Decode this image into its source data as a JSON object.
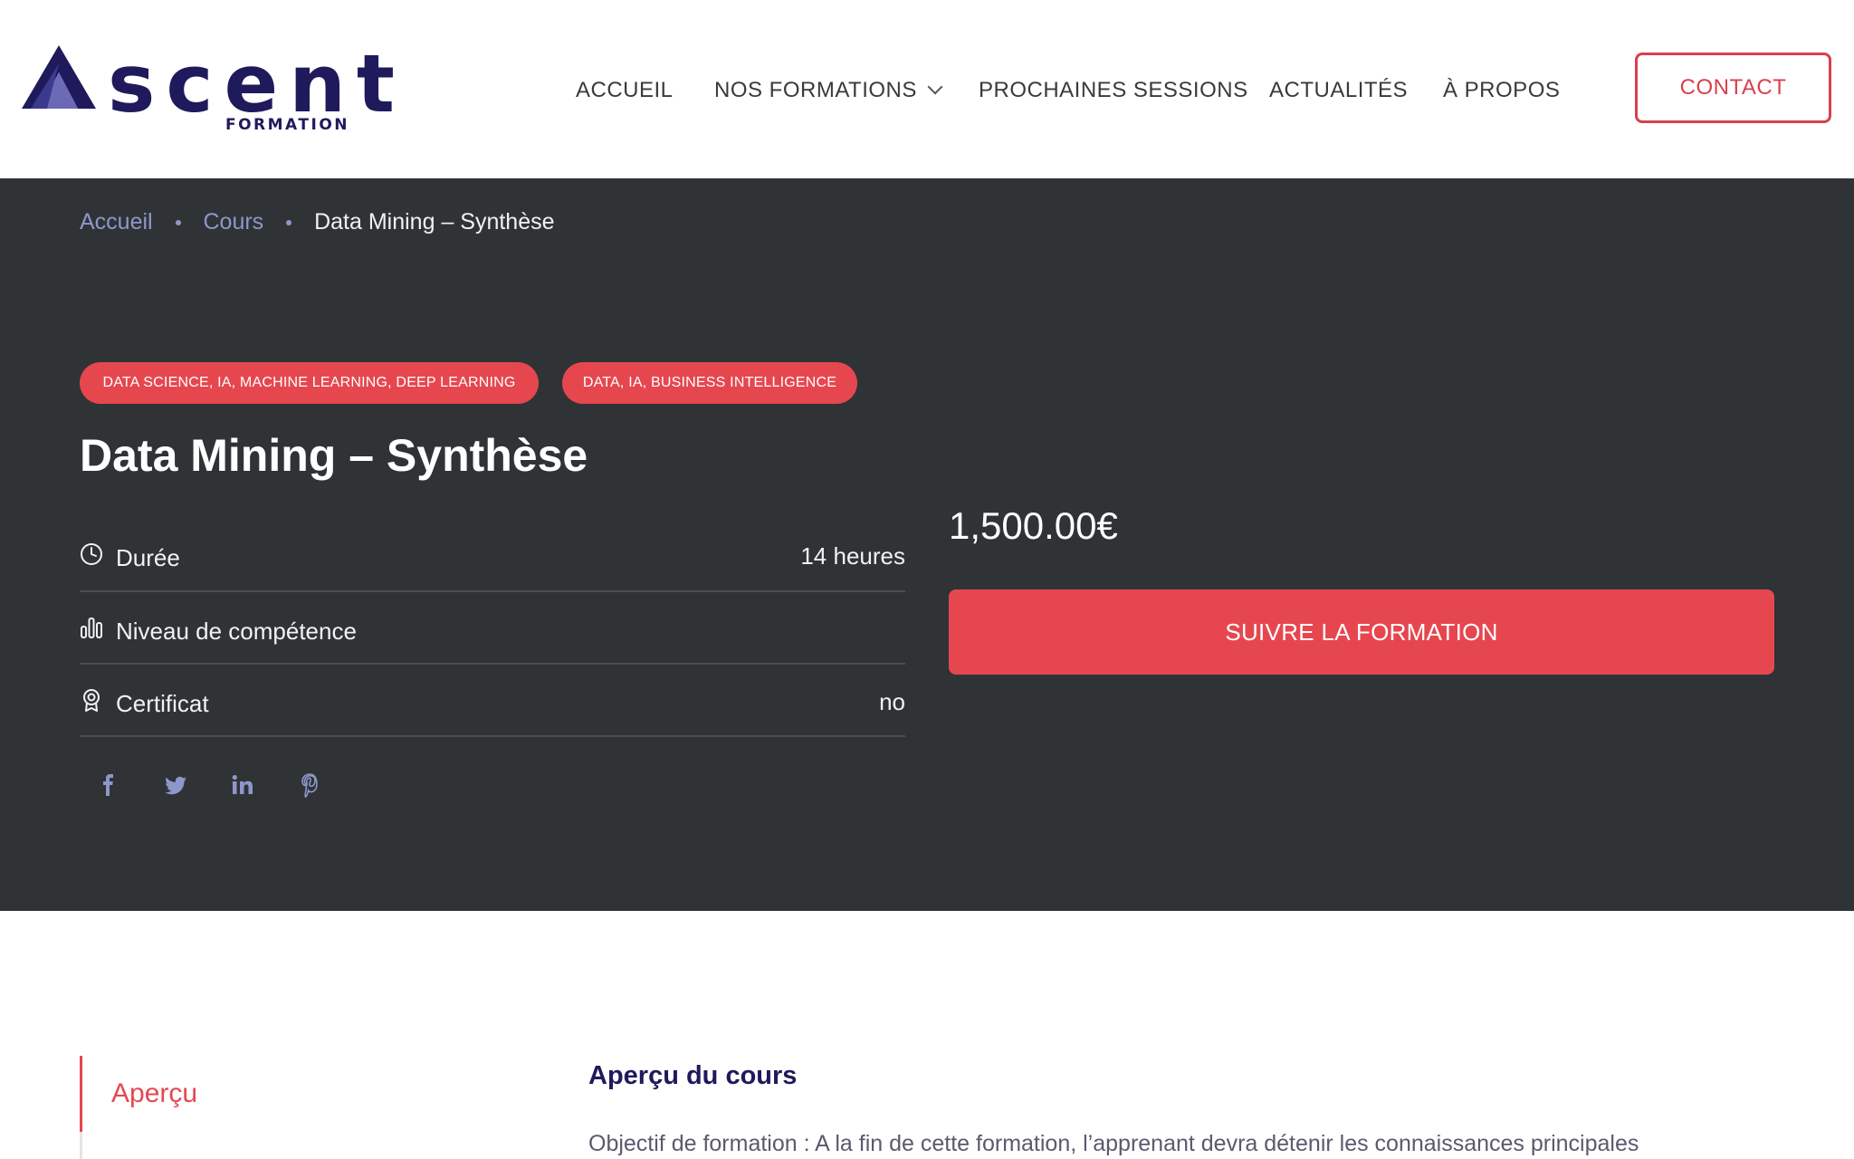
{
  "brand": {
    "name": "scent",
    "subtitle": "FORMATION",
    "primary_color": "#1f1a5c",
    "accent_color": "#e6474f"
  },
  "nav": {
    "items": [
      {
        "label": "ACCUEIL"
      },
      {
        "label": "NOS FORMATIONS",
        "has_dropdown": true
      },
      {
        "label": "PROCHAINES SESSIONS"
      },
      {
        "label": "ACTUALITÉS"
      },
      {
        "label": "À PROPOS"
      }
    ],
    "contact_label": "CONTACT"
  },
  "breadcrumb": {
    "items": [
      "Accueil",
      "Cours"
    ],
    "current": "Data Mining – Synthèse"
  },
  "course": {
    "categories": [
      "DATA SCIENCE, IA, MACHINE LEARNING, DEEP LEARNING",
      "DATA, IA, BUSINESS INTELLIGENCE"
    ],
    "title": "Data Mining – Synthèse",
    "info": [
      {
        "icon": "clock-icon",
        "label": "Durée",
        "value": "14 heures"
      },
      {
        "icon": "bar-chart-icon",
        "label": "Niveau de compétence",
        "value": ""
      },
      {
        "icon": "certificate-icon",
        "label": "Certificat",
        "value": "no"
      }
    ],
    "social": [
      "facebook-icon",
      "twitter-icon",
      "linkedin-icon",
      "pinterest-icon"
    ],
    "price": "1,500.00€",
    "cta_label": "SUIVRE LA FORMATION"
  },
  "content": {
    "active_tab": "Aperçu",
    "section_title": "Aperçu du cours",
    "text": "Objectif de formation : A la fin de cette formation, l’apprenant devra détenir les connaissances principales"
  }
}
